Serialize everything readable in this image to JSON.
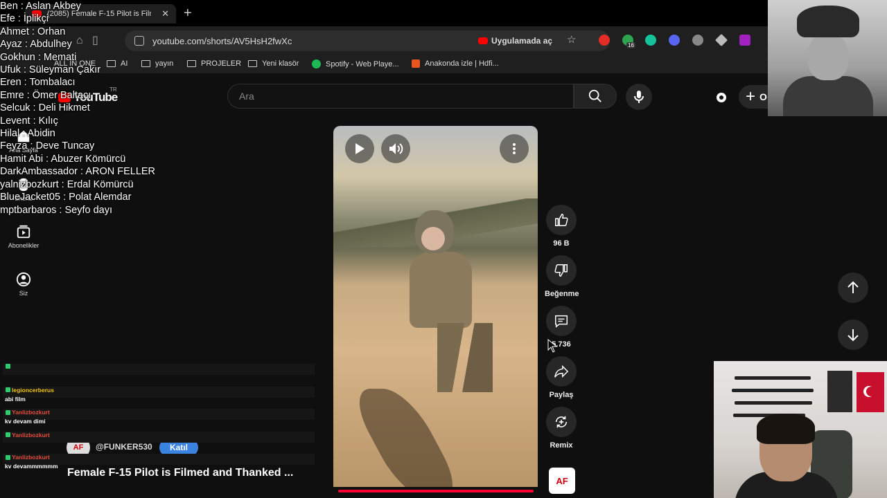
{
  "browser": {
    "tab_title": "(2085) Female F-15 Pilot is Film",
    "url": "youtube.com/shorts/AV5HsH2fwXc",
    "open_in_app": "Uygulamada aç",
    "extension_badge": "16",
    "bookmarks": [
      "ALL IN ONE",
      "AI",
      "yayın",
      "PROJELER",
      "Yeni klasör",
      "Spotify - Web Playe...",
      "Anakonda izle | Hdfi..."
    ]
  },
  "youtube": {
    "logo": "YouTube",
    "logo_region": "TR",
    "search_placeholder": "Ara",
    "create_label": "O",
    "sidebar": [
      {
        "label": "Ana Sayfa",
        "icon": "home-icon"
      },
      {
        "label": "Shorts",
        "icon": "shorts-icon"
      },
      {
        "label": "Abonelikler",
        "icon": "subscriptions-icon"
      },
      {
        "label": "Siz",
        "icon": "profile-icon"
      }
    ]
  },
  "short": {
    "channel_avatar_text": "AF",
    "channel": "@FUNKER530",
    "join_label": "Katıl",
    "title": "Female F-15 Pilot is Filmed and Thanked ...",
    "like_count": "96 B",
    "dislike_label": "Beğenme",
    "comment_count": "5.736",
    "share_label": "Paylaş",
    "remix_label": "Remix",
    "progress": 1.0
  },
  "overlay_names": [
    "Ben : Aslan Akbey",
    "Efe : İplikçi",
    "Ahmet : Orhan",
    "Ayaz : Abdulhey",
    "Gokhun : Memati",
    "Ufuk : Süleyman Çakır",
    "Eren : Tombalacı",
    "Emre : Ömer Baltacı",
    "Selcuk : Deli Hikmet",
    "Levent : Kılıç",
    "Hilal : Abidin",
    "Feyza : Deve Tuncay",
    "Hamit Abi : Abuzer Kömürcü",
    "DarkAmbassador : ARON FELLER",
    "yalnizbozkurt : Erdal Kömürcü",
    "BlueJacket05 : Polat Alemdar",
    "mptbarbaros : Seyfo dayı"
  ],
  "chat": [
    {
      "user": "",
      "user_color": "#c0392b",
      "message": ""
    },
    {
      "user": "legioncerberus",
      "user_color": "#f1c40f",
      "message": "abi film"
    },
    {
      "user": "Yanlizbozkurt",
      "user_color": "#e74c3c",
      "message": "kv devam dimi"
    },
    {
      "user": "Yanlizbozkurt",
      "user_color": "#e74c3c",
      "message": ""
    },
    {
      "user": "Yanlizbozkurt",
      "user_color": "#e74c3c",
      "message": "kv devammmmmm"
    }
  ],
  "colors": {
    "accent": "#ff0033",
    "join": "#3a83e0",
    "background": "#0f0f0f"
  }
}
